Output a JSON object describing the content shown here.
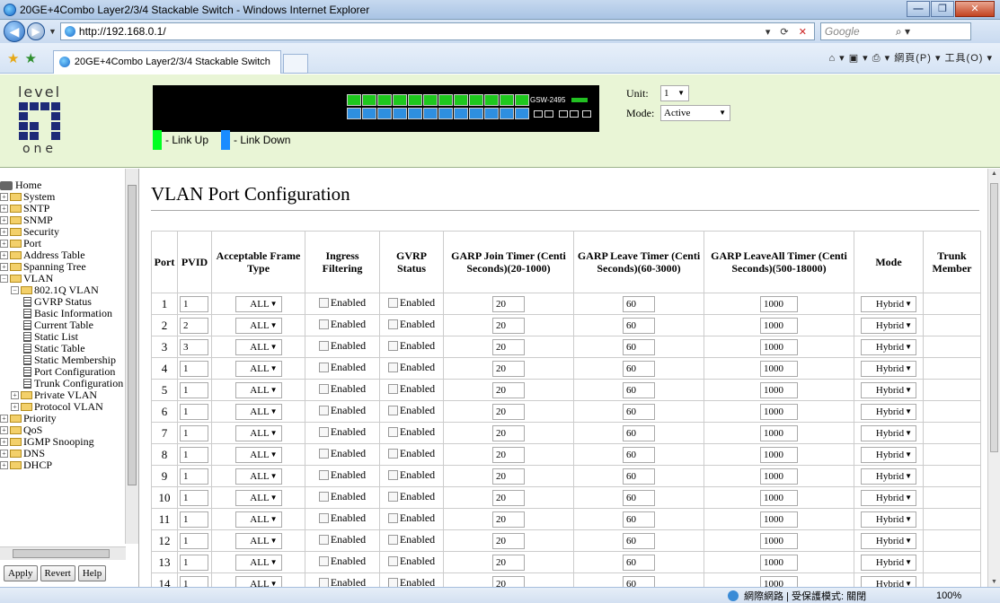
{
  "window": {
    "title": "20GE+4Combo Layer2/3/4 Stackable Switch - Windows Internet Explorer",
    "url": "http://192.168.0.1/",
    "search_placeholder": "Google",
    "tab_title": "20GE+4Combo Layer2/3/4 Stackable Switch",
    "command_bar": "網頁(P) ▾   工具(O) ▾"
  },
  "header": {
    "logo_top": "level",
    "logo_bottom": "one",
    "switch_model": "GSW-2495",
    "legend_up": "- Link Up",
    "legend_down": "- Link Down",
    "unit_label": "Unit:",
    "unit_value": "1",
    "mode_label": "Mode:",
    "mode_value": "Active"
  },
  "tree": [
    {
      "label": "Home",
      "type": "home",
      "indent": 0
    },
    {
      "label": "System",
      "type": "folder",
      "indent": 0
    },
    {
      "label": "SNTP",
      "type": "folder",
      "indent": 0
    },
    {
      "label": "SNMP",
      "type": "folder",
      "indent": 0
    },
    {
      "label": "Security",
      "type": "folder",
      "indent": 0
    },
    {
      "label": "Port",
      "type": "folder",
      "indent": 0
    },
    {
      "label": "Address Table",
      "type": "folder",
      "indent": 0
    },
    {
      "label": "Spanning Tree",
      "type": "folder",
      "indent": 0
    },
    {
      "label": "VLAN",
      "type": "folder-open",
      "indent": 0
    },
    {
      "label": "802.1Q VLAN",
      "type": "folder-open",
      "indent": 1
    },
    {
      "label": "GVRP Status",
      "type": "doc",
      "indent": 2
    },
    {
      "label": "Basic Information",
      "type": "doc",
      "indent": 2
    },
    {
      "label": "Current Table",
      "type": "doc",
      "indent": 2
    },
    {
      "label": "Static List",
      "type": "doc",
      "indent": 2
    },
    {
      "label": "Static Table",
      "type": "doc",
      "indent": 2
    },
    {
      "label": "Static Membership",
      "type": "doc",
      "indent": 2
    },
    {
      "label": "Port Configuration",
      "type": "doc",
      "indent": 2
    },
    {
      "label": "Trunk Configuration",
      "type": "doc",
      "indent": 2
    },
    {
      "label": "Private VLAN",
      "type": "folder",
      "indent": 1
    },
    {
      "label": "Protocol VLAN",
      "type": "folder",
      "indent": 1
    },
    {
      "label": "Priority",
      "type": "folder",
      "indent": 0
    },
    {
      "label": "QoS",
      "type": "folder",
      "indent": 0
    },
    {
      "label": "IGMP Snooping",
      "type": "folder",
      "indent": 0
    },
    {
      "label": "DNS",
      "type": "folder",
      "indent": 0
    },
    {
      "label": "DHCP",
      "type": "folder",
      "indent": 0
    }
  ],
  "tree_buttons": {
    "apply": "Apply",
    "revert": "Revert",
    "help": "Help"
  },
  "page": {
    "title": "VLAN Port Configuration",
    "columns": [
      "Port",
      "PVID",
      "Acceptable Frame Type",
      "Ingress Filtering",
      "GVRP Status",
      "GARP Join Timer (Centi Seconds)(20-1000)",
      "GARP Leave Timer (Centi Seconds)(60-3000)",
      "GARP LeaveAll Timer (Centi Seconds)(500-18000)",
      "Mode",
      "Trunk Member"
    ],
    "rows": [
      {
        "port": "1",
        "pvid": "1",
        "frame": "ALL",
        "ingress": "Enabled",
        "gvrp": "Enabled",
        "join": "20",
        "leave": "60",
        "leaveall": "1000",
        "mode": "Hybrid",
        "trunk": ""
      },
      {
        "port": "2",
        "pvid": "2",
        "frame": "ALL",
        "ingress": "Enabled",
        "gvrp": "Enabled",
        "join": "20",
        "leave": "60",
        "leaveall": "1000",
        "mode": "Hybrid",
        "trunk": ""
      },
      {
        "port": "3",
        "pvid": "3",
        "frame": "ALL",
        "ingress": "Enabled",
        "gvrp": "Enabled",
        "join": "20",
        "leave": "60",
        "leaveall": "1000",
        "mode": "Hybrid",
        "trunk": ""
      },
      {
        "port": "4",
        "pvid": "1",
        "frame": "ALL",
        "ingress": "Enabled",
        "gvrp": "Enabled",
        "join": "20",
        "leave": "60",
        "leaveall": "1000",
        "mode": "Hybrid",
        "trunk": ""
      },
      {
        "port": "5",
        "pvid": "1",
        "frame": "ALL",
        "ingress": "Enabled",
        "gvrp": "Enabled",
        "join": "20",
        "leave": "60",
        "leaveall": "1000",
        "mode": "Hybrid",
        "trunk": ""
      },
      {
        "port": "6",
        "pvid": "1",
        "frame": "ALL",
        "ingress": "Enabled",
        "gvrp": "Enabled",
        "join": "20",
        "leave": "60",
        "leaveall": "1000",
        "mode": "Hybrid",
        "trunk": ""
      },
      {
        "port": "7",
        "pvid": "1",
        "frame": "ALL",
        "ingress": "Enabled",
        "gvrp": "Enabled",
        "join": "20",
        "leave": "60",
        "leaveall": "1000",
        "mode": "Hybrid",
        "trunk": ""
      },
      {
        "port": "8",
        "pvid": "1",
        "frame": "ALL",
        "ingress": "Enabled",
        "gvrp": "Enabled",
        "join": "20",
        "leave": "60",
        "leaveall": "1000",
        "mode": "Hybrid",
        "trunk": ""
      },
      {
        "port": "9",
        "pvid": "1",
        "frame": "ALL",
        "ingress": "Enabled",
        "gvrp": "Enabled",
        "join": "20",
        "leave": "60",
        "leaveall": "1000",
        "mode": "Hybrid",
        "trunk": ""
      },
      {
        "port": "10",
        "pvid": "1",
        "frame": "ALL",
        "ingress": "Enabled",
        "gvrp": "Enabled",
        "join": "20",
        "leave": "60",
        "leaveall": "1000",
        "mode": "Hybrid",
        "trunk": ""
      },
      {
        "port": "11",
        "pvid": "1",
        "frame": "ALL",
        "ingress": "Enabled",
        "gvrp": "Enabled",
        "join": "20",
        "leave": "60",
        "leaveall": "1000",
        "mode": "Hybrid",
        "trunk": ""
      },
      {
        "port": "12",
        "pvid": "1",
        "frame": "ALL",
        "ingress": "Enabled",
        "gvrp": "Enabled",
        "join": "20",
        "leave": "60",
        "leaveall": "1000",
        "mode": "Hybrid",
        "trunk": ""
      },
      {
        "port": "13",
        "pvid": "1",
        "frame": "ALL",
        "ingress": "Enabled",
        "gvrp": "Enabled",
        "join": "20",
        "leave": "60",
        "leaveall": "1000",
        "mode": "Hybrid",
        "trunk": ""
      },
      {
        "port": "14",
        "pvid": "1",
        "frame": "ALL",
        "ingress": "Enabled",
        "gvrp": "Enabled",
        "join": "20",
        "leave": "60",
        "leaveall": "1000",
        "mode": "Hybrid",
        "trunk": ""
      }
    ]
  },
  "statusbar": {
    "zone": "網際網路 | 受保護模式: 關閉",
    "zoom": "100%"
  },
  "colors": {
    "link_up": "#00ff22",
    "link_down": "#1a8cff",
    "banner_bg": "#e9f5d6"
  }
}
